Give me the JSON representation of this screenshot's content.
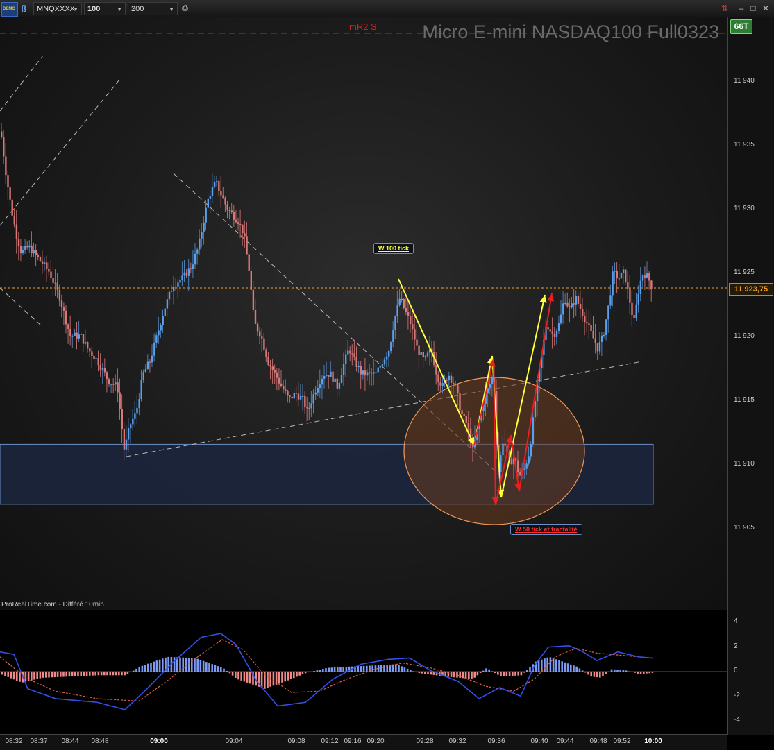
{
  "toolbar": {
    "demo_label": "DEMO",
    "symbol": "MNQXXXX",
    "interval": "100 ticks",
    "units": "200 unités",
    "icons": [
      "demo-icon",
      "ticker-icon",
      "caret-down-icon",
      "print-icon",
      "swap-icon",
      "minimize-icon",
      "maximize-icon",
      "close-icon"
    ]
  },
  "chart": {
    "instrument_title": "Micro E-mini NASDAQ100 Full0323",
    "level_label": "mR2 S",
    "source": "ProRealTime.com - Différé 10min",
    "badge": "66T",
    "current_price_label": "11 923,75",
    "annotation_top": "W 100 tick",
    "annotation_bottom": "W 50 tick et fractalité",
    "price_ticks": [
      "11 940",
      "11 935",
      "11 930",
      "11 925",
      "11 920",
      "11 915",
      "11 910",
      "11 905"
    ],
    "osc_ticks": [
      "4",
      "2",
      "0",
      "-2",
      "-4"
    ],
    "time_ticks": [
      "08:32",
      "08:37",
      "08:44",
      "08:48",
      "09:00",
      "09:04",
      "09:08",
      "09:12",
      "09:16",
      "09:20",
      "09:28",
      "09:32",
      "09:36",
      "09:40",
      "09:44",
      "09:48",
      "09:52",
      "10:00"
    ],
    "colors": {
      "up": "#5aa0f0",
      "down": "#d97878",
      "title": "#6a6a6a",
      "accent": "#f0a02a",
      "level": "#d02020",
      "zone": "#1c2640",
      "zone_border": "#6b8fc4",
      "circle": "#6a3a1e",
      "yellow_arrows": "#ffff3a",
      "red_arrows": "#e82020"
    }
  },
  "chart_data": {
    "type": "candlestick",
    "title": "Micro E-mini NASDAQ100 Full0323",
    "x_ticks": [
      "08:32",
      "08:37",
      "08:44",
      "08:48",
      "09:00",
      "09:04",
      "09:08",
      "09:12",
      "09:16",
      "09:20",
      "09:28",
      "09:32",
      "09:36",
      "09:40",
      "09:44",
      "09:48",
      "09:52",
      "10:00"
    ],
    "ylim": [
      11901,
      11945
    ],
    "close_path": [
      [
        0,
        11936
      ],
      [
        8,
        11932.5
      ],
      [
        15,
        11930
      ],
      [
        22,
        11928
      ],
      [
        30,
        11926.5
      ],
      [
        40,
        11927
      ],
      [
        55,
        11926
      ],
      [
        70,
        11925
      ],
      [
        85,
        11923
      ],
      [
        100,
        11920
      ],
      [
        115,
        11920
      ],
      [
        125,
        11919
      ],
      [
        140,
        11918
      ],
      [
        155,
        11916.5
      ],
      [
        168,
        11916
      ],
      [
        178,
        11911
      ],
      [
        186,
        11913
      ],
      [
        195,
        11914
      ],
      [
        205,
        11917
      ],
      [
        215,
        11918
      ],
      [
        225,
        11920
      ],
      [
        235,
        11922
      ],
      [
        248,
        11924
      ],
      [
        262,
        11924.5
      ],
      [
        275,
        11925.5
      ],
      [
        285,
        11927
      ],
      [
        292,
        11929
      ],
      [
        300,
        11931
      ],
      [
        310,
        11932
      ],
      [
        318,
        11931
      ],
      [
        326,
        11930
      ],
      [
        334,
        11929.5
      ],
      [
        342,
        11929
      ],
      [
        350,
        11928
      ],
      [
        358,
        11925
      ],
      [
        365,
        11921
      ],
      [
        375,
        11920
      ],
      [
        385,
        11918
      ],
      [
        395,
        11917
      ],
      [
        405,
        11916
      ],
      [
        415,
        11915
      ],
      [
        425,
        11915.5
      ],
      [
        435,
        11915
      ],
      [
        442,
        11914
      ],
      [
        448,
        11915
      ],
      [
        455,
        11916
      ],
      [
        465,
        11917
      ],
      [
        475,
        11917
      ],
      [
        485,
        11916
      ],
      [
        495,
        11918
      ],
      [
        502,
        11919
      ],
      [
        510,
        11918
      ],
      [
        520,
        11917
      ],
      [
        530,
        11917
      ],
      [
        540,
        11917
      ],
      [
        550,
        11918
      ],
      [
        560,
        11919
      ],
      [
        566,
        11921
      ],
      [
        575,
        11923
      ],
      [
        582,
        11922
      ],
      [
        590,
        11921
      ],
      [
        600,
        11919
      ],
      [
        610,
        11918
      ],
      [
        620,
        11919
      ],
      [
        628,
        11917
      ],
      [
        636,
        11916
      ],
      [
        645,
        11917
      ],
      [
        655,
        11916
      ],
      [
        663,
        11914
      ],
      [
        672,
        11913
      ],
      [
        680,
        11911
      ],
      [
        688,
        11913
      ],
      [
        696,
        11915
      ],
      [
        703,
        11916
      ],
      [
        710,
        11917
      ],
      [
        716,
        11909
      ],
      [
        724,
        11912
      ],
      [
        732,
        11910
      ],
      [
        740,
        11910.5
      ],
      [
        747,
        11909
      ],
      [
        754,
        11909.5
      ],
      [
        762,
        11911
      ],
      [
        770,
        11915
      ],
      [
        778,
        11918
      ],
      [
        786,
        11921
      ],
      [
        796,
        11920
      ],
      [
        805,
        11921
      ],
      [
        812,
        11923
      ],
      [
        820,
        11922
      ],
      [
        828,
        11923
      ],
      [
        836,
        11922
      ],
      [
        844,
        11921
      ],
      [
        852,
        11920
      ],
      [
        860,
        11919
      ],
      [
        868,
        11920
      ],
      [
        876,
        11922.5
      ],
      [
        882,
        11925
      ],
      [
        890,
        11924.5
      ],
      [
        898,
        11925
      ],
      [
        905,
        11923
      ],
      [
        912,
        11921
      ],
      [
        920,
        11924
      ],
      [
        926,
        11925
      ],
      [
        933,
        11924.5
      ],
      [
        940,
        11923.5
      ]
    ],
    "levels": [
      {
        "name": "mR2 S",
        "value": 11944
      },
      {
        "name": "current",
        "value": 11923.75
      }
    ],
    "support_zone": [
      11906.8,
      11911.5
    ],
    "oscillator": {
      "ylim": [
        -5,
        5
      ],
      "hist": [
        [
          0,
          -0.2
        ],
        [
          30,
          -0.9
        ],
        [
          60,
          -0.5
        ],
        [
          100,
          -0.4
        ],
        [
          140,
          -0.3
        ],
        [
          180,
          -0.3
        ],
        [
          200,
          0.4
        ],
        [
          240,
          1.2
        ],
        [
          280,
          1.1
        ],
        [
          320,
          0.3
        ],
        [
          340,
          -0.6
        ],
        [
          380,
          -1.4
        ],
        [
          410,
          -0.8
        ],
        [
          440,
          -0.1
        ],
        [
          470,
          0.3
        ],
        [
          500,
          0.4
        ],
        [
          540,
          0.5
        ],
        [
          570,
          0.6
        ],
        [
          600,
          -0.1
        ],
        [
          640,
          -0.4
        ],
        [
          680,
          -0.6
        ],
        [
          700,
          0.3
        ],
        [
          720,
          -0.4
        ],
        [
          750,
          -0.3
        ],
        [
          770,
          0.8
        ],
        [
          790,
          1.2
        ],
        [
          830,
          0.4
        ],
        [
          850,
          -0.4
        ],
        [
          865,
          -0.5
        ],
        [
          880,
          0.2
        ],
        [
          900,
          0.1
        ],
        [
          920,
          -0.2
        ],
        [
          940,
          -0.1
        ]
      ],
      "line": [
        [
          0,
          1.6
        ],
        [
          20,
          1.4
        ],
        [
          40,
          -1.4
        ],
        [
          80,
          -2.2
        ],
        [
          140,
          -2.5
        ],
        [
          180,
          -3.1
        ],
        [
          210,
          -1.5
        ],
        [
          250,
          0.8
        ],
        [
          290,
          2.8
        ],
        [
          318,
          3.1
        ],
        [
          340,
          2.2
        ],
        [
          370,
          -0.8
        ],
        [
          400,
          -2.8
        ],
        [
          440,
          -2.5
        ],
        [
          480,
          -0.6
        ],
        [
          520,
          0.6
        ],
        [
          560,
          1.0
        ],
        [
          590,
          1.1
        ],
        [
          620,
          0.1
        ],
        [
          660,
          -0.8
        ],
        [
          690,
          -2.2
        ],
        [
          720,
          -1.3
        ],
        [
          750,
          -2.0
        ],
        [
          770,
          0.5
        ],
        [
          790,
          2.0
        ],
        [
          820,
          2.1
        ],
        [
          840,
          1.6
        ],
        [
          860,
          0.9
        ],
        [
          890,
          1.6
        ],
        [
          920,
          1.2
        ],
        [
          940,
          1.1
        ]
      ],
      "signal": [
        [
          0,
          1.2
        ],
        [
          40,
          -0.6
        ],
        [
          80,
          -1.6
        ],
        [
          140,
          -2.2
        ],
        [
          200,
          -2.4
        ],
        [
          240,
          -0.8
        ],
        [
          280,
          1.0
        ],
        [
          320,
          2.6
        ],
        [
          350,
          1.8
        ],
        [
          380,
          -0.2
        ],
        [
          420,
          -1.7
        ],
        [
          460,
          -1.6
        ],
        [
          500,
          -0.6
        ],
        [
          540,
          0.2
        ],
        [
          580,
          0.7
        ],
        [
          620,
          0.3
        ],
        [
          660,
          -0.3
        ],
        [
          700,
          -1.2
        ],
        [
          740,
          -1.6
        ],
        [
          770,
          -0.6
        ],
        [
          800,
          1.2
        ],
        [
          830,
          1.9
        ],
        [
          860,
          1.5
        ],
        [
          900,
          1.3
        ],
        [
          940,
          1.1
        ]
      ]
    }
  }
}
